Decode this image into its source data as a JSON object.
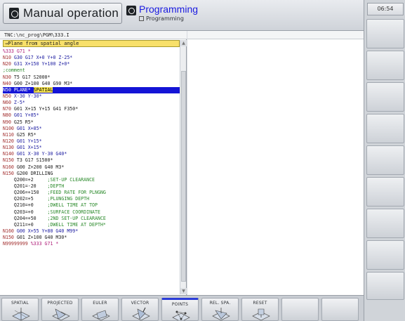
{
  "header": {
    "mode_label": "Manual operation",
    "sub_mode_label": "Programming",
    "sub_mode_caption": "Programming"
  },
  "clock": "06:54",
  "editor": {
    "path": "TNC:\\nc_prog\\PGM\\333.I",
    "title": "→Plane from spatial angle",
    "lines": [
      [
        {
          "t": "%333 G71 *",
          "c": "c-pct"
        }
      ],
      [
        {
          "t": "N10 ",
          "c": "c-blk"
        },
        {
          "t": "G30 G17 X+0 Y+0 Z-25*",
          "c": "c-num"
        }
      ],
      [
        {
          "t": "N20 ",
          "c": "c-blk"
        },
        {
          "t": "G31 X+150 Y+100 Z+0*",
          "c": "c-num"
        }
      ],
      [
        {
          "t": ";comment",
          "c": "c-cmt"
        }
      ],
      [
        {
          "t": "N30 ",
          "c": "c-blk"
        },
        {
          "t": "T5 G17 S2000*",
          "c": "c-cmd"
        }
      ],
      [
        {
          "t": "N40 ",
          "c": "c-blk"
        },
        {
          "t": "G00 Z+100 G40 G90 M3*",
          "c": "c-cmd"
        }
      ],
      [
        {
          "t": "N50 PLANE* ",
          "c": "c-cmd"
        },
        {
          "t": "SPATIAL",
          "c": "yw"
        }
      ],
      [
        {
          "t": "N50 ",
          "c": "c-blk"
        },
        {
          "t": "X-30 Y-30*",
          "c": "c-num"
        }
      ],
      [
        {
          "t": "N60 ",
          "c": "c-blk"
        },
        {
          "t": "Z-5*",
          "c": "c-num"
        }
      ],
      [
        {
          "t": "N70 ",
          "c": "c-blk"
        },
        {
          "t": "G01 X+15 Y+15 G41 F350*",
          "c": "c-cmd"
        }
      ],
      [
        {
          "t": "N80 ",
          "c": "c-blk"
        },
        {
          "t": "G01 Y+85*",
          "c": "c-num"
        }
      ],
      [
        {
          "t": "N90 ",
          "c": "c-blk"
        },
        {
          "t": "G25 R5*",
          "c": "c-cmd"
        }
      ],
      [
        {
          "t": "N100 ",
          "c": "c-blk"
        },
        {
          "t": "G01 X+85*",
          "c": "c-num"
        }
      ],
      [
        {
          "t": "N110 ",
          "c": "c-blk"
        },
        {
          "t": "G25 R5*",
          "c": "c-cmd"
        }
      ],
      [
        {
          "t": "N120 ",
          "c": "c-blk"
        },
        {
          "t": "G01 Y+15*",
          "c": "c-num"
        }
      ],
      [
        {
          "t": "N130 ",
          "c": "c-blk"
        },
        {
          "t": "G01 X+15*",
          "c": "c-num"
        }
      ],
      [
        {
          "t": "N140 ",
          "c": "c-blk"
        },
        {
          "t": "G01 X-30 Y-30 G40*",
          "c": "c-num"
        }
      ],
      [
        {
          "t": "N150 ",
          "c": "c-blk"
        },
        {
          "t": "T3 G17 S1500*",
          "c": "c-cmd"
        }
      ],
      [
        {
          "t": "N160 ",
          "c": "c-blk"
        },
        {
          "t": "G00 Z+200 G40 M3*",
          "c": "c-cmd"
        }
      ],
      [
        {
          "t": "N150 ",
          "c": "c-blk"
        },
        {
          "t": "G200 DRILLING",
          "c": "c-cmd"
        }
      ],
      [
        {
          "t": "    Q200=+2     ",
          "c": "c-cmd"
        },
        {
          "t": ";SET-UP CLEARANCE",
          "c": "c-cmt"
        }
      ],
      [
        {
          "t": "    Q201=-20    ",
          "c": "c-cmd"
        },
        {
          "t": ";DEPTH",
          "c": "c-cmt"
        }
      ],
      [
        {
          "t": "    Q206=+150   ",
          "c": "c-cmd"
        },
        {
          "t": ";FEED RATE FOR PLNGNG",
          "c": "c-cmt"
        }
      ],
      [
        {
          "t": "    Q202=+5     ",
          "c": "c-cmd"
        },
        {
          "t": ";PLUNGING DEPTH",
          "c": "c-cmt"
        }
      ],
      [
        {
          "t": "    Q210=+0     ",
          "c": "c-cmd"
        },
        {
          "t": ";DWELL TIME AT TOP",
          "c": "c-cmt"
        }
      ],
      [
        {
          "t": "    Q203=+0     ",
          "c": "c-cmd"
        },
        {
          "t": ";SURFACE COORDINATE",
          "c": "c-cmt"
        }
      ],
      [
        {
          "t": "    Q204=+50    ",
          "c": "c-cmd"
        },
        {
          "t": ";2ND SET-UP CLEARANCE",
          "c": "c-cmt"
        }
      ],
      [
        {
          "t": "    Q211=+0     ",
          "c": "c-cmd"
        },
        {
          "t": ";DWELL TIME AT DEPTH*",
          "c": "c-cmt"
        }
      ],
      [
        {
          "t": "N160 ",
          "c": "c-blk"
        },
        {
          "t": "G00 X+55 Y+80 G40 M99*",
          "c": "c-num"
        }
      ],
      [
        {
          "t": "N150 ",
          "c": "c-blk"
        },
        {
          "t": "G01 Z+100 G40 M30*",
          "c": "c-cmd"
        }
      ],
      [
        {
          "t": "N99999999 ",
          "c": "c-blk"
        },
        {
          "t": "%333 G71 *",
          "c": "c-pct"
        }
      ]
    ],
    "highlighted_line": 6
  },
  "softkeys": [
    {
      "label": "SPATIAL",
      "active": false
    },
    {
      "label": "PROJECTED",
      "active": false
    },
    {
      "label": "EULER",
      "active": false
    },
    {
      "label": "VECTOR",
      "active": false
    },
    {
      "label": "POINTS",
      "active": true
    },
    {
      "label": "REL. SPA.",
      "active": false
    },
    {
      "label": "RESET",
      "active": false
    },
    {
      "label": "",
      "active": false
    },
    {
      "label": "",
      "active": false
    }
  ],
  "colors": {
    "highlight": "#1414d6",
    "title_bar": "#f8e06a",
    "accent": "#2b3dd8"
  }
}
